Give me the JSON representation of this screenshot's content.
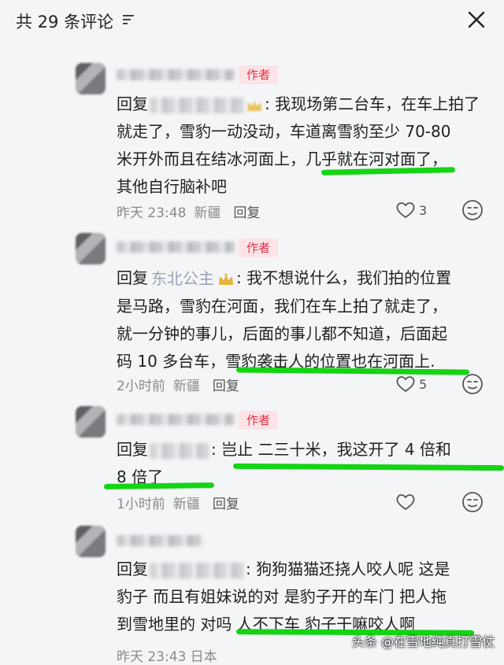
{
  "header": {
    "title": "共 29 条评论"
  },
  "comments": [
    {
      "badge": "作者",
      "reply_label": "回复",
      "reply_target": "",
      "line1": "我现场第二台车，在车上拍了",
      "line2": "就走了，雪豹一动没动，车道离雪豹至少 70-80",
      "line3": "米开外而且在结冰河面上，几乎就在河对面了，",
      "line4": "其他自行脑补吧",
      "time": "昨天 23:48",
      "location": "新疆",
      "reply_btn": "回复",
      "likes": "3"
    },
    {
      "badge": "作者",
      "reply_label": "回复",
      "reply_target": "东北公主",
      "line1": "我不想说什么，我们拍的位置",
      "line2": "是马路，雪豹在河面，我们在车上拍了就走了，",
      "line3": "就一分钟的事儿，后面的事儿都不知道，后面起",
      "line4": "码 10 多台车，雪豹袭击人的位置也在河面上.",
      "time": "2小时前",
      "location": "新疆",
      "reply_btn": "回复",
      "likes": "5"
    },
    {
      "badge": "作者",
      "reply_label": "回复",
      "reply_target": "",
      "line1": "岂止 二三十米，我这开了 4 倍和",
      "line2": "8 倍了",
      "time": "1小时前",
      "location": "新疆",
      "reply_btn": "回复"
    },
    {
      "reply_label": "回复",
      "reply_target": "",
      "line1": "狗狗猫猫还挠人咬人呢 这是",
      "line2": "豹子 而且有姐妹说的对 是豹子开的车门 把人拖",
      "line3": "到雪地里的 对吗 人不下车 豹子干嘛咬人啊",
      "time_partial": "昨天 23:43 日本"
    }
  ],
  "watermark": "头条 @在雪地纯真打雪仗",
  "colors": {
    "highlight": "#14d414",
    "author_badge_bg": "#fde3e6",
    "author_badge_text": "#e0314b",
    "meta_text": "#8a8a8a"
  },
  "icons": [
    "sort-icon",
    "close-icon",
    "heart-icon",
    "emoji-icon",
    "crown-icon"
  ]
}
